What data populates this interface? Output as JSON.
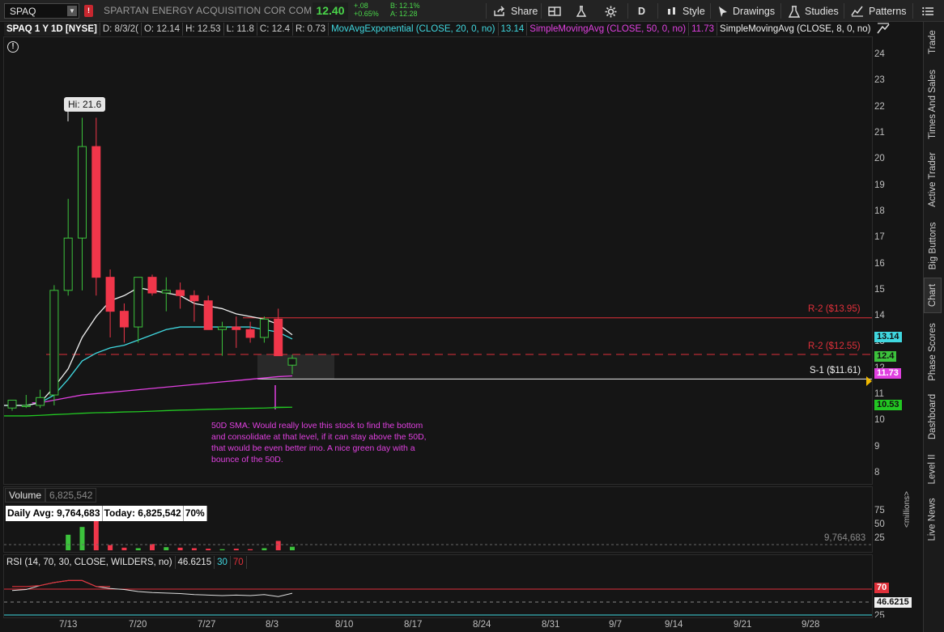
{
  "toolbar": {
    "symbol": "SPAQ",
    "description": "SPARTAN ENERGY ACQUISITION COR COM CL A",
    "last": "12.40",
    "change": "+.08",
    "change_pct": "+0.65%",
    "bid": "B: 12.1%",
    "ask": "A: 12.28",
    "share_label": "Share",
    "period_label": "D",
    "style_label": "Style",
    "drawings_label": "Drawings",
    "studies_label": "Studies",
    "patterns_label": "Patterns"
  },
  "study_bar": {
    "symbol_period": "SPAQ 1 Y 1D [NYSE]",
    "date": "D: 8/3/2(",
    "open": "O: 12.14",
    "high": "H: 12.53",
    "low": "L: 11.8",
    "close": "C: 12.4",
    "range": "R: 0.73",
    "ema_label": "MovAvgExponential (CLOSE, 20, 0, no)",
    "ema_value": "13.14",
    "sma50_label": "SimpleMovingAvg (CLOSE, 50, 0, no)",
    "sma50_value": "11.73",
    "sma8_label": "SimpleMovingAvg (CLOSE, 8, 0, no)",
    "more": "..."
  },
  "annotations": {
    "hi_bubble": "Hi: 21.6",
    "r2_high": "R-2 ($13.95)",
    "r2_low": "R-2 ($12.55)",
    "s1": "S-1 ($11.61)",
    "note_lines": [
      "50D SMA: Would really love this stock to find the bottom",
      "and consolidate at that level, if it can stay above the 50D,",
      "that would be even better imo. A nice green day with a",
      "bounce of the 50D."
    ]
  },
  "price_tags": {
    "ema": "13.14",
    "last": "12.4",
    "sma50": "11.73",
    "sma_long": "10.53"
  },
  "price_axis": [
    "24",
    "23",
    "22",
    "21",
    "20",
    "19",
    "18",
    "17",
    "16",
    "15",
    "14",
    "13",
    "12",
    "11",
    "10",
    "9",
    "8"
  ],
  "volume": {
    "label": "Volume",
    "value": "6,825,542",
    "daily_avg": "Daily Avg: 9,764,683",
    "today": "Today: 6,825,542",
    "pct": "70%",
    "avg_line": "9,764,683",
    "axis": [
      "75",
      "50",
      "25"
    ],
    "axis_unit": "<millions>"
  },
  "rsi": {
    "label": "RSI (14, 70, 30, CLOSE, WILDERS, no)",
    "value": "46.6215",
    "lower": "30",
    "upper": "70",
    "tag_upper": "70",
    "tag_value": "46.6215",
    "tag_partial": "25"
  },
  "dates": [
    "7/13",
    "7/20",
    "7/27",
    "8/3",
    "8/10",
    "8/17",
    "8/24",
    "8/31",
    "9/7",
    "9/14",
    "9/21",
    "9/28"
  ],
  "sidebar": [
    "Trade",
    "Times And Sales",
    "Active Trader",
    "Big Buttons",
    "Chart",
    "Phase Scores",
    "Dashboard",
    "Level II",
    "Live News"
  ],
  "colors": {
    "up": "#3cc23c",
    "down": "#f0364a",
    "ema": "#40d8e0",
    "sma50": "#e040e0",
    "sma_long": "#22c722",
    "sma8": "#f0f0f0",
    "resistance": "#e0303a",
    "support": "#e8e8e8"
  },
  "chart_data": {
    "type": "candlestick",
    "x": [
      "7/6",
      "7/7",
      "7/8",
      "7/9",
      "7/10",
      "7/13",
      "7/14",
      "7/15",
      "7/16",
      "7/17",
      "7/20",
      "7/21",
      "7/22",
      "7/23",
      "7/24",
      "7/27",
      "7/28",
      "7/29",
      "7/30",
      "7/31",
      "8/3"
    ],
    "open": [
      10.5,
      10.6,
      10.6,
      11.0,
      15.0,
      17.0,
      20.5,
      15.5,
      14.2,
      13.6,
      15.5,
      14.9,
      15.0,
      14.8,
      14.6,
      13.5,
      13.6,
      13.5,
      13.2,
      13.9,
      12.14
    ],
    "high": [
      10.8,
      11.0,
      11.2,
      15.2,
      18.5,
      21.6,
      21.6,
      15.8,
      14.5,
      13.9,
      15.6,
      15.5,
      15.3,
      15.0,
      14.8,
      13.8,
      14.0,
      13.8,
      14.0,
      14.3,
      12.53
    ],
    "low": [
      10.4,
      10.5,
      10.5,
      10.6,
      14.8,
      15.0,
      14.8,
      13.2,
      13.0,
      13.0,
      14.8,
      14.2,
      14.3,
      13.8,
      13.6,
      12.5,
      12.8,
      13.0,
      13.0,
      12.8,
      11.8
    ],
    "close": [
      10.8,
      10.6,
      10.9,
      15.0,
      17.0,
      20.5,
      15.5,
      14.2,
      13.6,
      15.5,
      14.9,
      15.0,
      14.8,
      14.6,
      13.5,
      13.6,
      13.5,
      13.2,
      13.9,
      12.5,
      12.4
    ],
    "ylim": [
      8,
      24
    ],
    "series": [
      {
        "name": "MovAvgExponential (CLOSE, 20, 0, no)",
        "values": [
          10.6,
          10.6,
          10.7,
          11.0,
          11.6,
          12.3,
          12.6,
          12.8,
          12.9,
          13.1,
          13.3,
          13.5,
          13.6,
          13.6,
          13.6,
          13.6,
          13.6,
          13.6,
          13.5,
          13.4,
          13.14
        ]
      },
      {
        "name": "SimpleMovingAvg (CLOSE, 50, 0, no)",
        "values": [
          null,
          null,
          10.7,
          10.8,
          10.9,
          11.0,
          11.05,
          11.1,
          11.15,
          11.2,
          11.25,
          11.3,
          11.35,
          11.4,
          11.45,
          11.5,
          11.55,
          11.6,
          11.65,
          11.7,
          11.73
        ]
      },
      {
        "name": "SimpleMovingAvg (CLOSE, 8, 0, no)",
        "values": [
          10.6,
          10.6,
          10.7,
          11.3,
          12.0,
          13.2,
          14.0,
          14.6,
          14.8,
          15.1,
          15.0,
          14.9,
          14.8,
          14.5,
          14.4,
          14.3,
          14.1,
          14.0,
          13.9,
          13.7,
          13.3
        ]
      },
      {
        "name": "long",
        "values": [
          10.2,
          10.2,
          10.22,
          10.25,
          10.27,
          10.3,
          10.32,
          10.33,
          10.35,
          10.36,
          10.38,
          10.4,
          10.42,
          10.43,
          10.45,
          10.46,
          10.48,
          10.49,
          10.5,
          10.52,
          10.53
        ]
      }
    ],
    "volume_millions": [
      0,
      0,
      0,
      0,
      30,
      45,
      60,
      10,
      5,
      4,
      12,
      6,
      5,
      4,
      3,
      2,
      3,
      2,
      4,
      18,
      6.8
    ],
    "rsi": [
      52,
      54,
      62,
      68,
      72,
      72,
      60,
      56,
      54,
      50,
      48,
      47,
      46,
      44,
      43,
      42,
      43,
      42,
      44,
      40,
      46.6
    ]
  }
}
